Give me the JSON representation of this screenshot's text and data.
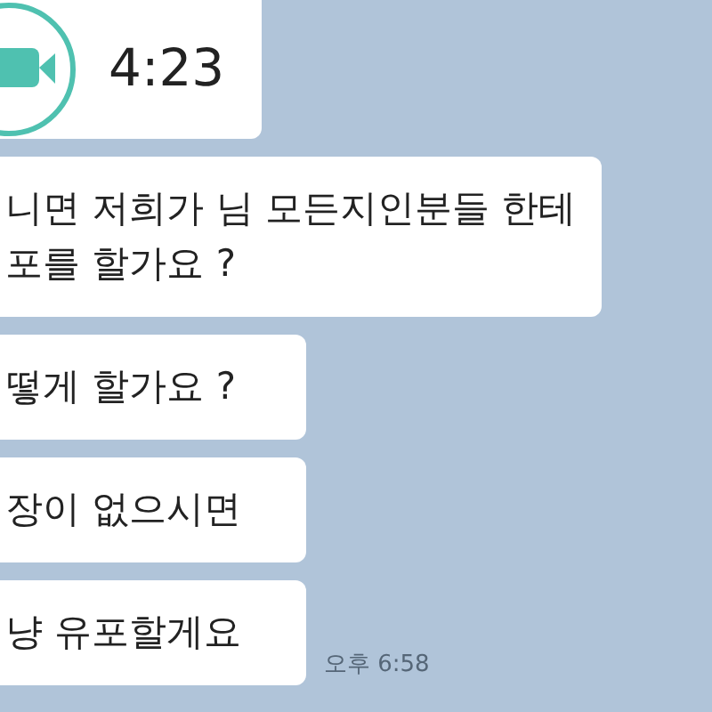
{
  "messages": [
    {
      "kind": "video_call",
      "text": "4:23"
    },
    {
      "kind": "text",
      "text": "니면 저희가 님 모든지인분들 한테\n포를 할가요 ?"
    },
    {
      "kind": "text",
      "text": "떻게 할가요 ?"
    },
    {
      "kind": "text",
      "text": "장이 없으시면"
    },
    {
      "kind": "text",
      "text": "냥 유포할게요",
      "time": "오후 6:58"
    }
  ]
}
